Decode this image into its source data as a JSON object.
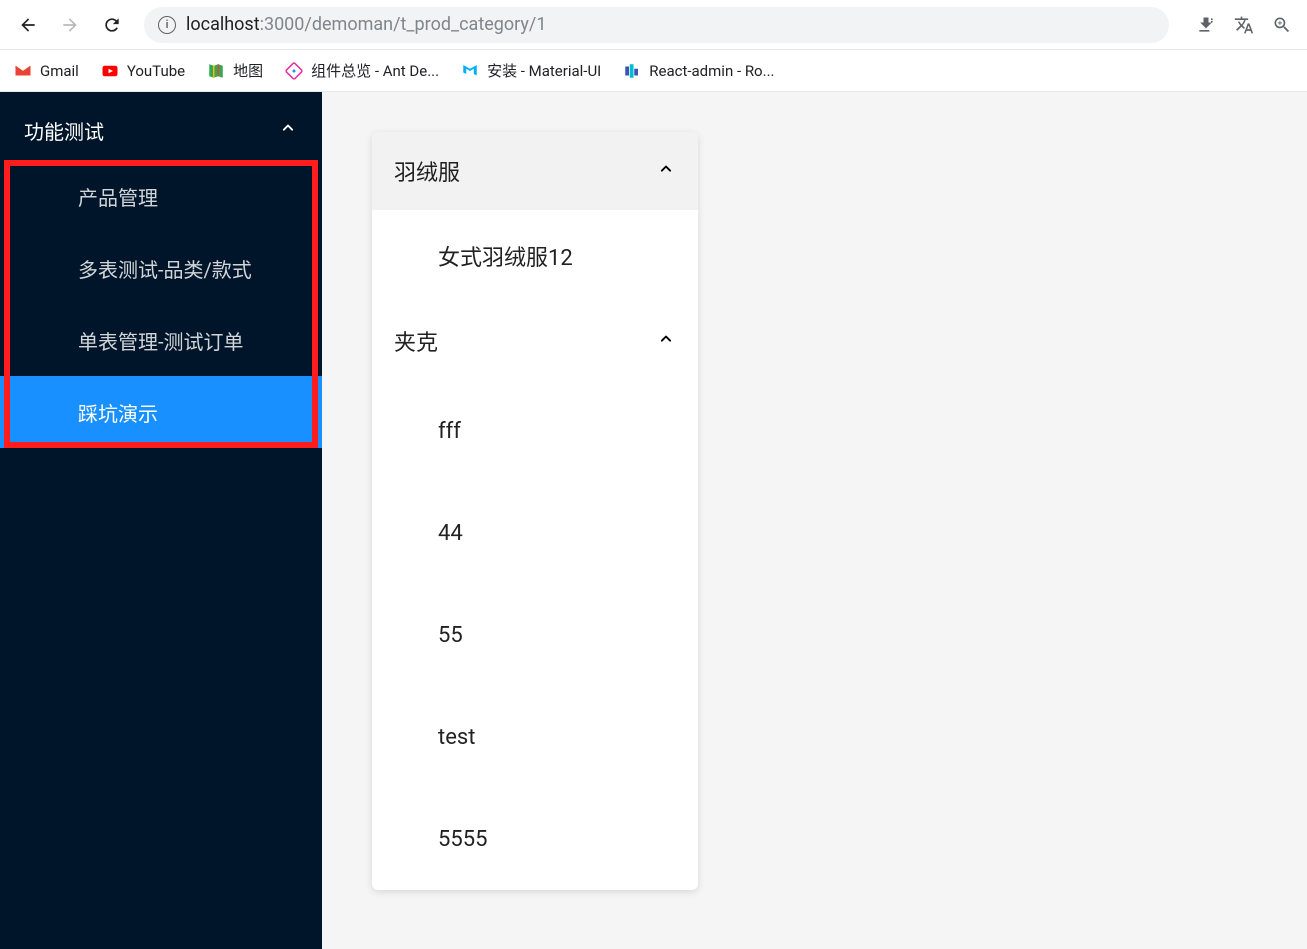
{
  "url": {
    "host": "localhost",
    "port_path": ":3000/demoman/t_prod_category/1"
  },
  "bookmarks": [
    {
      "label": "Gmail",
      "icon": "gmail"
    },
    {
      "label": "YouTube",
      "icon": "youtube"
    },
    {
      "label": "地图",
      "icon": "maps"
    },
    {
      "label": "组件总览 - Ant De...",
      "icon": "antd"
    },
    {
      "label": "安装 - Material-UI",
      "icon": "mui"
    },
    {
      "label": "React-admin - Ro...",
      "icon": "react-admin"
    }
  ],
  "sidebar": {
    "group_label": "功能测试",
    "items": [
      {
        "label": "产品管理",
        "active": false
      },
      {
        "label": "多表测试-品类/款式",
        "active": false
      },
      {
        "label": "单表管理-测试订单",
        "active": false
      },
      {
        "label": "踩坑演示",
        "active": true
      }
    ]
  },
  "panel": {
    "sections": [
      {
        "title": "羽绒服",
        "items": [
          "女式羽绒服12"
        ],
        "header_bg": true
      },
      {
        "title": "夹克",
        "items": [
          "fff",
          "44",
          "55",
          "test",
          "5555"
        ],
        "header_bg": false
      }
    ]
  }
}
